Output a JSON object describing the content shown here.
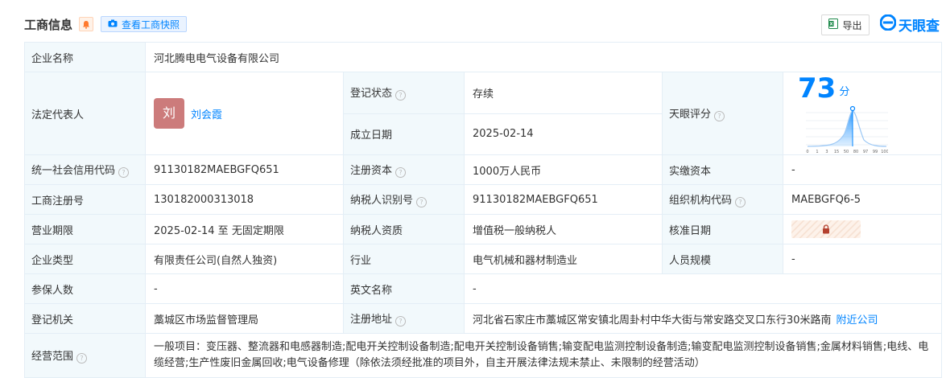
{
  "header": {
    "title": "工商信息",
    "snapshot_button": "查看工商快照",
    "export_button": "导出",
    "brand": "天眼查"
  },
  "rows": {
    "company_name": {
      "label": "企业名称",
      "value": "河北腾电电气设备有限公司"
    },
    "legal_rep": {
      "label": "法定代表人",
      "avatar": "刘",
      "name": "刘会霞"
    },
    "reg_status": {
      "label": "登记状态",
      "value": "存续"
    },
    "founded": {
      "label": "成立日期",
      "value": "2025-02-14"
    },
    "tianyan_score": {
      "label": "天眼评分",
      "score": "73",
      "unit": "分",
      "chart_ticks": [
        "0",
        "1",
        "3",
        "15",
        "50",
        "80",
        "97",
        "99",
        "100"
      ]
    },
    "credit_code": {
      "label": "统一社会信用代码",
      "value": "91130182MAEBGFQ651"
    },
    "reg_capital": {
      "label": "注册资本",
      "value": "1000万人民币"
    },
    "paid_capital": {
      "label": "实缴资本",
      "value": "-"
    },
    "reg_number": {
      "label": "工商注册号",
      "value": "130182000313018"
    },
    "taxpayer_id": {
      "label": "纳税人识别号",
      "value": "91130182MAEBGFQ651"
    },
    "org_code": {
      "label": "组织机构代码",
      "value": "MAEBGFQ6-5"
    },
    "business_term": {
      "label": "营业期限",
      "value": "2025-02-14 至 无固定期限"
    },
    "taxpayer_qual": {
      "label": "纳税人资质",
      "value": "增值税一般纳税人"
    },
    "approval_date": {
      "label": "核准日期",
      "locked": true
    },
    "company_type": {
      "label": "企业类型",
      "value": "有限责任公司(自然人独资)"
    },
    "industry": {
      "label": "行业",
      "value": "电气机械和器材制造业"
    },
    "staff_size": {
      "label": "人员规模",
      "value": "-"
    },
    "insured": {
      "label": "参保人数",
      "value": "-"
    },
    "english_name": {
      "label": "英文名称",
      "value": "-"
    },
    "reg_authority": {
      "label": "登记机关",
      "value": "藁城区市场监督管理局"
    },
    "reg_address": {
      "label": "注册地址",
      "value": "河北省石家庄市藁城区常安镇北周卦村中华大街与常安路交叉口东行30米路南",
      "link": "附近公司"
    },
    "scope": {
      "label": "经营范围",
      "value": "一般项目：变压器、整流器和电感器制造;配电开关控制设备制造;配电开关控制设备销售;输变配电监测控制设备制造;输变配电监测控制设备销售;金属材料销售;电线、电缆经营;生产性废旧金属回收;电气设备修理（除依法须经批准的项目外，自主开展法律法规未禁止、未限制的经营活动）"
    }
  },
  "colors": {
    "accent": "#0084ff",
    "status_green": "#00a046",
    "label_bg": "#f2f9fc",
    "border": "#e4eef6"
  },
  "icons": [
    "bell-icon",
    "camera-icon",
    "excel-icon",
    "tianyancha-logo-icon",
    "help-icon",
    "lock-icon"
  ]
}
